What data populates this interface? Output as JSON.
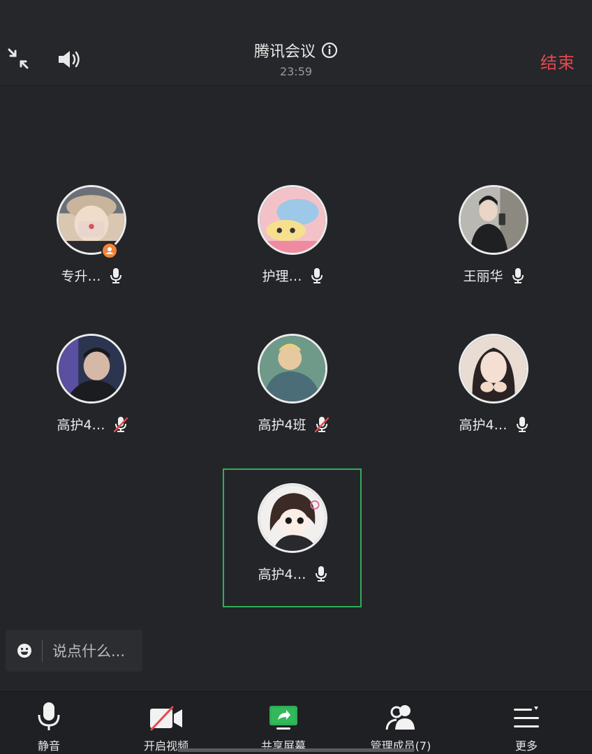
{
  "header": {
    "title": "腾讯会议",
    "time": "23:59",
    "end_label": "结束"
  },
  "participants": [
    {
      "name": "专升…",
      "mic": "on",
      "host": true
    },
    {
      "name": "护理…",
      "mic": "on",
      "host": false
    },
    {
      "name": "王丽华",
      "mic": "on",
      "host": false
    },
    {
      "name": "高护4…",
      "mic": "muted",
      "host": false
    },
    {
      "name": "高护4班",
      "mic": "muted",
      "host": false
    },
    {
      "name": "高护4…",
      "mic": "on",
      "host": false
    },
    {
      "name": "高护4…",
      "mic": "on",
      "host": false,
      "speaking": true
    }
  ],
  "chat": {
    "placeholder": "说点什么..."
  },
  "toolbar": {
    "mute_label": "静音",
    "video_label": "开启视频",
    "share_label": "共享屏幕",
    "members_label": "管理成员(7)",
    "more_label": "更多"
  },
  "colors": {
    "end": "#e5484d",
    "speaking_frame": "#2fae57",
    "share_icon": "#2fae57",
    "host_badge": "#f0843a"
  }
}
